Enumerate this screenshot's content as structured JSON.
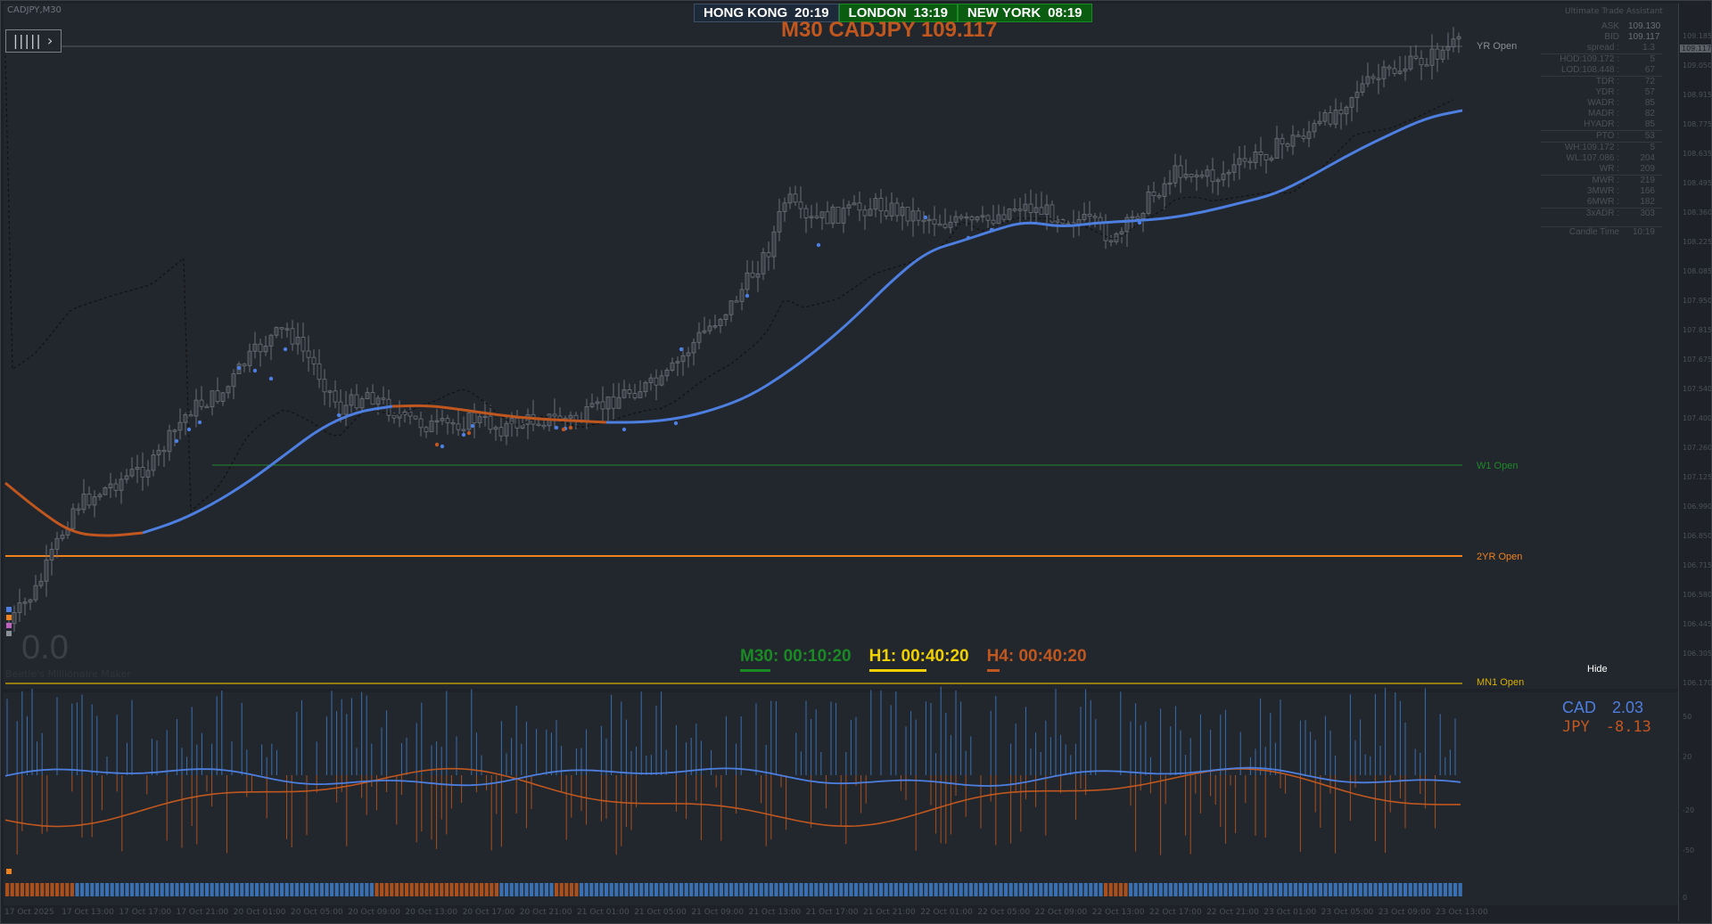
{
  "symbol": "CADJPY,M30",
  "nav_button": "|||||",
  "clocks": [
    {
      "city": "HONG KONG",
      "time": "20:19"
    },
    {
      "city": "LONDON",
      "time": "13:19"
    },
    {
      "city": "NEW YORK",
      "time": "08:19"
    }
  ],
  "title": "M30 CADJPY 109.117",
  "lines": {
    "yr_open": "YR Open",
    "w1_open": "W1 Open",
    "yr2_open": "2YR Open",
    "mn1_open": "MN1 Open"
  },
  "colors": {
    "bull_ma": "#4d7fe0",
    "bear_ma": "#c0571f",
    "w1_line": "#1f8a2a",
    "yr2_line": "#f0821e",
    "mn1_line": "#d9b000",
    "yr_line": "#8a8f98"
  },
  "uta": {
    "title": "Ultimate Trade Assistant",
    "ask_label": "ASK",
    "ask_value": "109.130",
    "bid_label": "BID",
    "bid_value": "109.117",
    "rows": [
      {
        "k": "spread :",
        "v": "1.3"
      },
      {
        "k": "HOD:109.172 :",
        "v": "5"
      },
      {
        "k": "LOD:108.448 :",
        "v": "67"
      },
      {
        "k": "TDR :",
        "v": "72"
      },
      {
        "k": "YDR :",
        "v": "57"
      },
      {
        "k": "WADR :",
        "v": "85"
      },
      {
        "k": "MADR :",
        "v": "82"
      },
      {
        "k": "HYADR :",
        "v": "85"
      },
      {
        "k": "PTO :",
        "v": "53"
      },
      {
        "k": "WH:109.172 :",
        "v": "5"
      },
      {
        "k": "WL:107.086 :",
        "v": "204"
      },
      {
        "k": "WR :",
        "v": "209"
      },
      {
        "k": "MWR :",
        "v": "219"
      },
      {
        "k": "3MWR :",
        "v": "166"
      },
      {
        "k": "6MWR :",
        "v": "182"
      },
      {
        "k": "3xADR :",
        "v": "303"
      },
      {
        "k": "Candle Time",
        "v": "10:19"
      }
    ]
  },
  "timers": [
    {
      "label": "M30: 00:10:20",
      "color": "#1a8a24"
    },
    {
      "label": "H1: 00:40:20",
      "color": "#f0d000"
    },
    {
      "label": "H4: 00:40:20",
      "color": "#c0571f"
    }
  ],
  "big_zero": "0.0",
  "watermark": "Beetle's Millionaire Maker",
  "hide_label": "Hide",
  "strength": {
    "cad_label": "CAD",
    "cad_value": "2.03",
    "jpy_label": "JPY",
    "jpy_value": "-8.13"
  },
  "price_scale": [
    "109.185",
    "109.050",
    "108.915",
    "108.775",
    "108.635",
    "108.495",
    "108.360",
    "108.225",
    "108.085",
    "107.950",
    "107.815",
    "107.675",
    "107.540",
    "107.400",
    "107.260",
    "107.125",
    "106.990",
    "106.850",
    "106.715",
    "106.580",
    "106.445",
    "106.305",
    "106.170"
  ],
  "price_scale_current": "109.117",
  "osc_scale": [
    "50",
    "20",
    "-20",
    "-50",
    "0"
  ],
  "time_axis": [
    "17 Oct 2025",
    "17 Oct 13:00",
    "17 Oct 17:00",
    "17 Oct 21:00",
    "20 Oct 01:00",
    "20 Oct 05:00",
    "20 Oct 09:00",
    "20 Oct 13:00",
    "20 Oct 17:00",
    "20 Oct 21:00",
    "21 Oct 01:00",
    "21 Oct 05:00",
    "21 Oct 09:00",
    "21 Oct 13:00",
    "21 Oct 17:00",
    "21 Oct 21:00",
    "22 Oct 01:00",
    "22 Oct 05:00",
    "22 Oct 09:00",
    "22 Oct 13:00",
    "22 Oct 17:00",
    "22 Oct 21:00",
    "23 Oct 01:00",
    "23 Oct 05:00",
    "23 Oct 09:00",
    "23 Oct 13:00"
  ]
}
